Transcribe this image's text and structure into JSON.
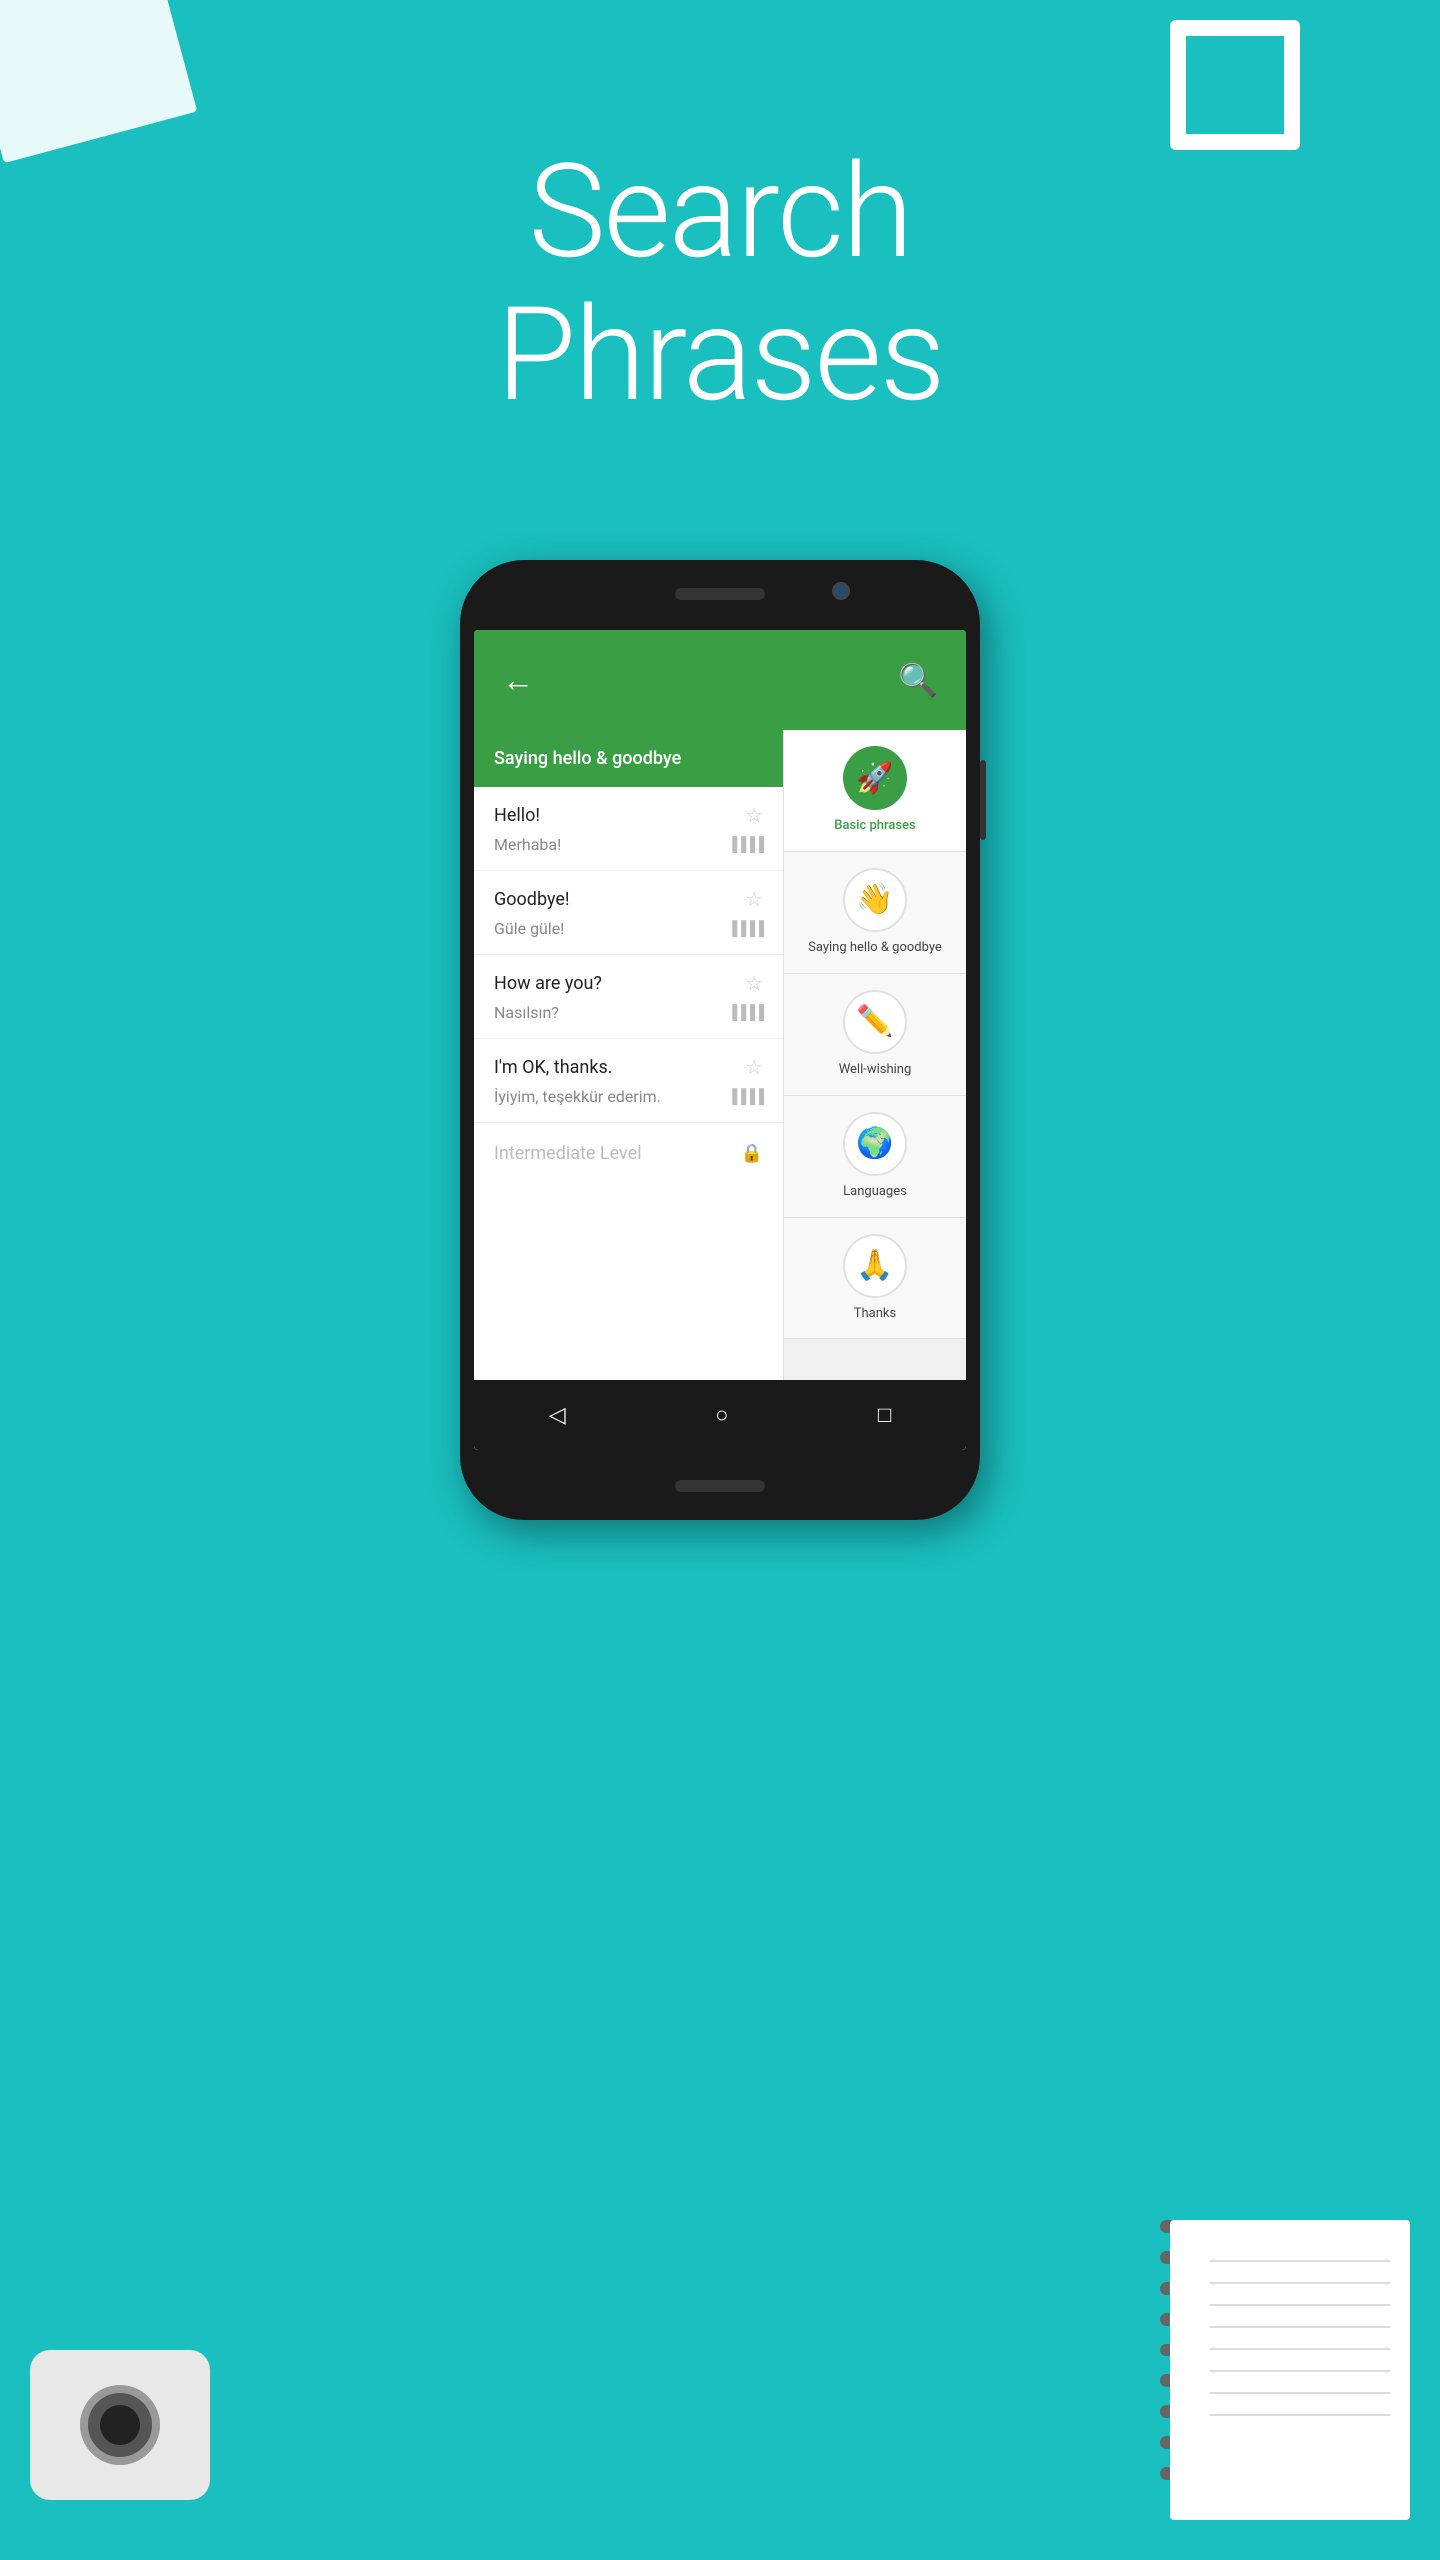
{
  "background_color": "#1ABFBF",
  "heading": {
    "line1": "Search",
    "line2": "Phrases"
  },
  "app": {
    "header": {
      "back_label": "←",
      "search_label": "🔍"
    },
    "left_panel": {
      "category_header": "Saying hello & goodbye",
      "phrases": [
        {
          "english": "Hello!",
          "translation": "Merhaba!",
          "has_star": true,
          "has_bars": false
        },
        {
          "english": "Goodbye!",
          "translation": "Güle güle!",
          "has_star": true,
          "has_bars": false
        },
        {
          "english": "How are you?",
          "translation": "Nasılsın?",
          "has_star": true,
          "has_bars": false
        },
        {
          "english": "I'm OK, thanks.",
          "translation": "İyiyim, teşekkür ederim.",
          "has_star": true,
          "has_bars": false
        }
      ],
      "locked_item": "Intermediate Level"
    },
    "right_panel": {
      "categories": [
        {
          "label": "Basic phrases",
          "icon": "🚀",
          "active": true,
          "color": "green"
        },
        {
          "label": "Saying hello & goodbye",
          "icon": "👋",
          "active": false,
          "color": "white"
        },
        {
          "label": "Well-wishing",
          "icon": "✏️",
          "active": false,
          "color": "white"
        },
        {
          "label": "Languages",
          "icon": "🌍",
          "active": false,
          "color": "white"
        },
        {
          "label": "Thanks",
          "icon": "🙏",
          "active": false,
          "color": "white"
        }
      ]
    }
  },
  "nav": {
    "back": "◁",
    "home": "○",
    "recent": "□"
  }
}
